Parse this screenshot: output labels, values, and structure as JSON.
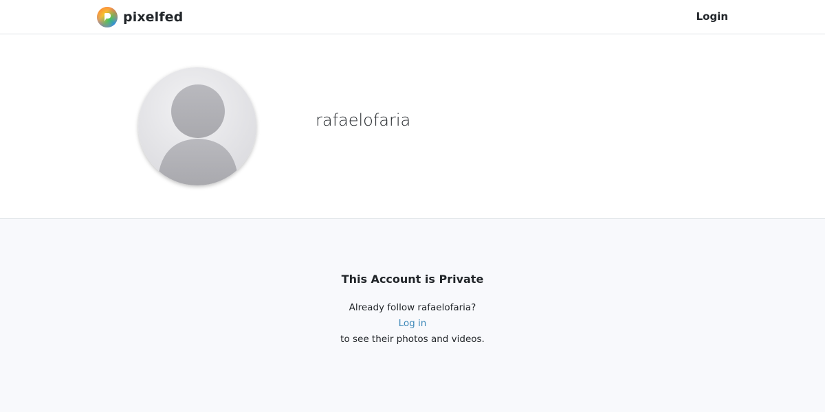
{
  "header": {
    "brand_name": "pixelfed",
    "login_label": "Login"
  },
  "profile": {
    "username": "rafaelofaria"
  },
  "private_notice": {
    "title": "This Account is Private",
    "follow_prompt": "Already follow rafaelofaria?",
    "login_link_label": "Log in",
    "follow_up_text": "to see their photos and videos."
  },
  "colors": {
    "link": "#3d88b8",
    "section_bg": "#f8f9fc",
    "border": "#dee2e6"
  },
  "icons": {
    "brand": "pixelfed-logo-icon",
    "avatar": "default-avatar-icon"
  }
}
